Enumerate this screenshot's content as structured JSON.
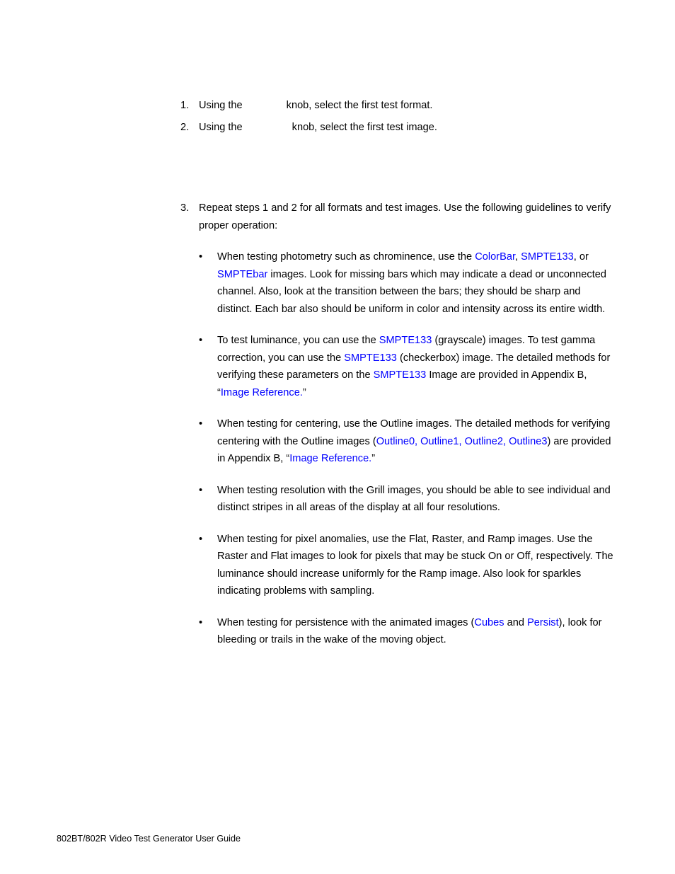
{
  "document": {
    "footer_text": "802BT/802R Video Test Generator User Guide",
    "link_color": "#0000FF",
    "text_color": "#000000",
    "page_background": "#FFFFFF"
  },
  "procedure": {
    "steps": [
      {
        "number": "1.",
        "text_before_gap": "Using the",
        "text_after_gap": "knob, select the first test format."
      },
      {
        "number": "2.",
        "text_before_gap": "Using the",
        "text_after_gap": "knob, select the first test image."
      }
    ],
    "step3": {
      "number": "3.",
      "text": "Repeat steps 1 and 2 for all formats and test images. Use the following guidelines to verify proper operation:",
      "bullet_marker": "•",
      "bullets": [
        {
          "marker": "•",
          "segments": [
            {
              "text": "When testing photometry such as chrominence, use the ",
              "link": false
            },
            {
              "text": "ColorBar",
              "link": true
            },
            {
              "text": ", ",
              "link": false
            },
            {
              "text": "SMPTE133",
              "link": true
            },
            {
              "text": ", or ",
              "link": false
            },
            {
              "text": "SMPTEbar",
              "link": true
            },
            {
              "text": " images. Look for missing bars which may indicate a dead or unconnected channel. Also, look at the transition between the bars; they should be sharp and distinct. Each bar also should be uniform in color and intensity across its entire width.",
              "link": false
            }
          ]
        },
        {
          "marker": "•",
          "segments": [
            {
              "text": "To test luminance, you can use the ",
              "link": false
            },
            {
              "text": "SMPTE133",
              "link": true
            },
            {
              "text": " (grayscale) images. To test gamma correction, you can use the ",
              "link": false
            },
            {
              "text": "SMPTE133",
              "link": true
            },
            {
              "text": " (checkerbox) image. The detailed methods for verifying these parameters on the ",
              "link": false
            },
            {
              "text": "SMPTE133",
              "link": true
            },
            {
              "text": " Image are provided in Appendix B, “",
              "link": false
            },
            {
              "text": "Image Reference.",
              "link": true
            },
            {
              "text": "”",
              "link": false
            }
          ]
        },
        {
          "marker": "•",
          "segments": [
            {
              "text": "When testing for centering, use the Outline images. The detailed methods for verifying centering with the Outline images (",
              "link": false
            },
            {
              "text": "Outline0, Outline1, Outline2, Outline3",
              "link": true
            },
            {
              "text": ") are provided in Appendix B, “",
              "link": false
            },
            {
              "text": "Image Reference.",
              "link": true
            },
            {
              "text": "”",
              "link": false
            }
          ]
        },
        {
          "marker": "•",
          "segments": [
            {
              "text": "When testing resolution with the Grill images, you should be able to see individual and distinct stripes in all areas of the display at all four resolutions.",
              "link": false
            }
          ]
        },
        {
          "marker": "•",
          "segments": [
            {
              "text": "When testing for pixel anomalies, use the Flat, Raster, and Ramp images. Use the Raster and Flat images to look for pixels that may be stuck On or Off, respectively. The luminance should increase uniformly for the Ramp image. Also look for sparkles indicating problems with sampling.",
              "link": false
            }
          ]
        },
        {
          "marker": "•",
          "segments": [
            {
              "text": "When testing for persistence with the animated images (",
              "link": false
            },
            {
              "text": "Cubes",
              "link": true
            },
            {
              "text": " and ",
              "link": false
            },
            {
              "text": "Persist",
              "link": true
            },
            {
              "text": "), look for bleeding or trails in the wake of the moving object.",
              "link": false
            }
          ]
        }
      ]
    }
  }
}
